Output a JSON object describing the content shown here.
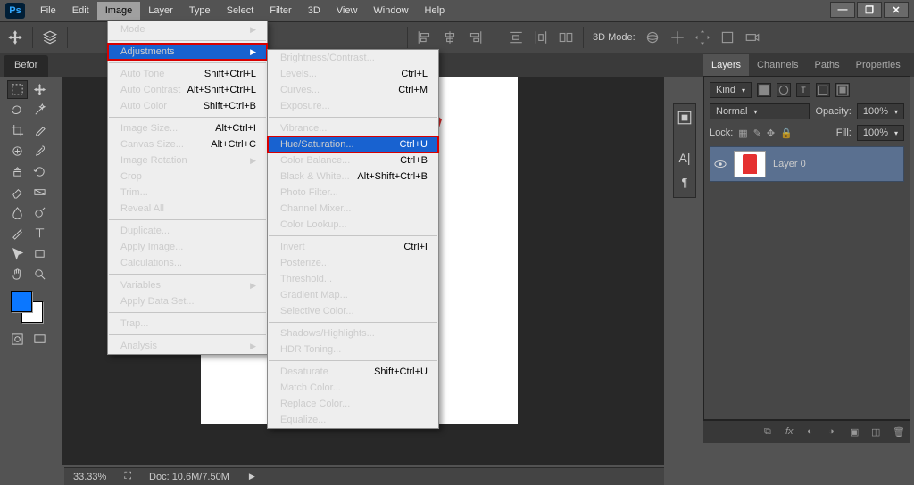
{
  "app": {
    "logo": "Ps"
  },
  "menubar": [
    "File",
    "Edit",
    "Image",
    "Layer",
    "Type",
    "Select",
    "Filter",
    "3D",
    "View",
    "Window",
    "Help"
  ],
  "open_menu_index": 2,
  "optionsbar": {
    "mode_label": "3D Mode:"
  },
  "document": {
    "tab_label": "Befor"
  },
  "image_menu": {
    "items": [
      {
        "label": "Mode",
        "sub": true
      },
      {
        "sep": true
      },
      {
        "label": "Adjustments",
        "sub": true,
        "hl": true
      },
      {
        "sep": true
      },
      {
        "label": "Auto Tone",
        "sc": "Shift+Ctrl+L"
      },
      {
        "label": "Auto Contrast",
        "sc": "Alt+Shift+Ctrl+L"
      },
      {
        "label": "Auto Color",
        "sc": "Shift+Ctrl+B"
      },
      {
        "sep": true
      },
      {
        "label": "Image Size...",
        "sc": "Alt+Ctrl+I"
      },
      {
        "label": "Canvas Size...",
        "sc": "Alt+Ctrl+C"
      },
      {
        "label": "Image Rotation",
        "sub": true
      },
      {
        "label": "Crop"
      },
      {
        "label": "Trim..."
      },
      {
        "label": "Reveal All"
      },
      {
        "sep": true
      },
      {
        "label": "Duplicate..."
      },
      {
        "label": "Apply Image..."
      },
      {
        "label": "Calculations..."
      },
      {
        "sep": true
      },
      {
        "label": "Variables",
        "sub": true
      },
      {
        "label": "Apply Data Set...",
        "dis": true
      },
      {
        "sep": true
      },
      {
        "label": "Trap...",
        "dis": true
      },
      {
        "sep": true
      },
      {
        "label": "Analysis",
        "sub": true
      }
    ]
  },
  "adjustments_menu": {
    "items": [
      {
        "label": "Brightness/Contrast..."
      },
      {
        "label": "Levels...",
        "sc": "Ctrl+L"
      },
      {
        "label": "Curves...",
        "sc": "Ctrl+M"
      },
      {
        "label": "Exposure..."
      },
      {
        "sep": true
      },
      {
        "label": "Vibrance..."
      },
      {
        "label": "Hue/Saturation...",
        "sc": "Ctrl+U",
        "hl": true
      },
      {
        "label": "Color Balance...",
        "sc": "Ctrl+B"
      },
      {
        "label": "Black & White...",
        "sc": "Alt+Shift+Ctrl+B"
      },
      {
        "label": "Photo Filter..."
      },
      {
        "label": "Channel Mixer..."
      },
      {
        "label": "Color Lookup..."
      },
      {
        "sep": true
      },
      {
        "label": "Invert",
        "sc": "Ctrl+I"
      },
      {
        "label": "Posterize..."
      },
      {
        "label": "Threshold..."
      },
      {
        "label": "Gradient Map..."
      },
      {
        "label": "Selective Color..."
      },
      {
        "sep": true
      },
      {
        "label": "Shadows/Highlights..."
      },
      {
        "label": "HDR Toning...",
        "dis": true
      },
      {
        "sep": true
      },
      {
        "label": "Desaturate",
        "sc": "Shift+Ctrl+U"
      },
      {
        "label": "Match Color..."
      },
      {
        "label": "Replace Color..."
      },
      {
        "label": "Equalize..."
      }
    ]
  },
  "layers_panel": {
    "tabs": [
      "Layers",
      "Channels",
      "Paths",
      "Properties"
    ],
    "active_tab": 0,
    "kind_label": "Kind",
    "blend_mode": "Normal",
    "opacity_label": "Opacity:",
    "opacity_value": "100%",
    "lock_label": "Lock:",
    "fill_label": "Fill:",
    "fill_value": "100%",
    "layers": [
      {
        "name": "Layer 0",
        "visible": true
      }
    ]
  },
  "statusbar": {
    "zoom": "33.33%",
    "doc": "Doc: 10.6M/7.50M"
  },
  "colors": {
    "accent": "#1862d0",
    "highlight_outline": "#d90000",
    "fg_swatch": "#0b77ff",
    "bg_swatch": "#ffffff",
    "shirt": "#e52e2e"
  }
}
